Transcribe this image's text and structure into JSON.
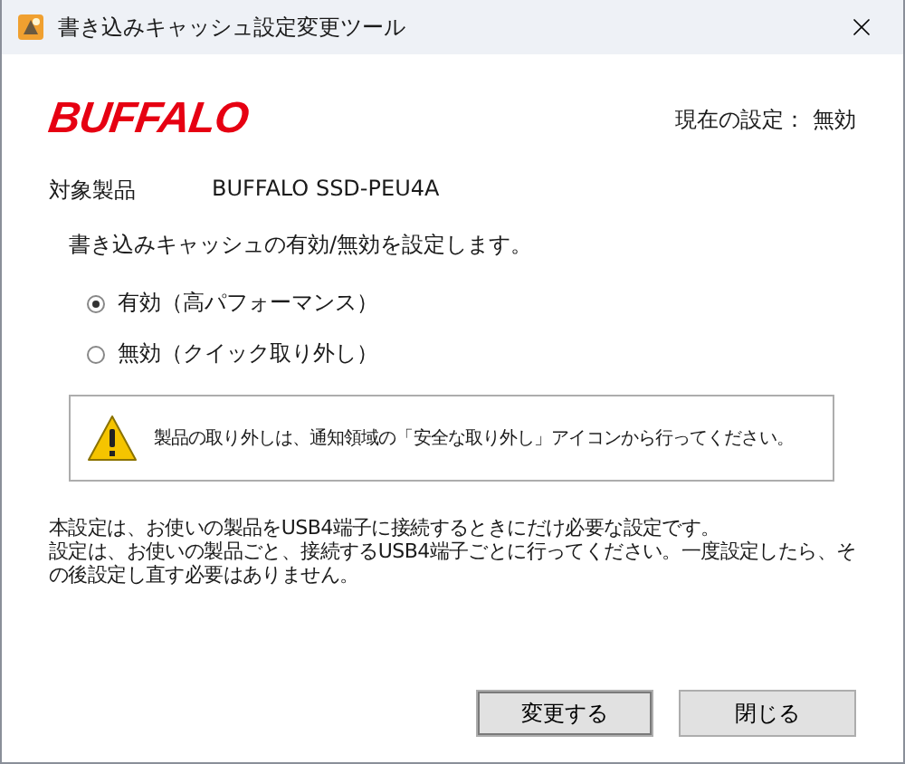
{
  "window": {
    "title": "書き込みキャッシュ設定変更ツール"
  },
  "logo": "BUFFALO",
  "current_setting": {
    "label": "現在の設定：",
    "value": "無効"
  },
  "product": {
    "label": "対象製品",
    "value": "BUFFALO SSD-PEU4A"
  },
  "instruction": "書き込みキャッシュの有効/無効を設定します。",
  "options": [
    {
      "label": "有効（高パフォーマンス）",
      "selected": true
    },
    {
      "label": "無効（クイック取り外し）",
      "selected": false
    }
  ],
  "warning": "製品の取り外しは、通知領域の「安全な取り外し」アイコンから行ってください。",
  "notes": [
    "本設定は、お使いの製品をUSB4端子に接続するときにだけ必要な設定です。",
    "設定は、お使いの製品ごと、接続するUSB4端子ごとに行ってください。一度設定したら、その後設定し直す必要はありません。"
  ],
  "buttons": [
    "変更する",
    "閉じる"
  ]
}
